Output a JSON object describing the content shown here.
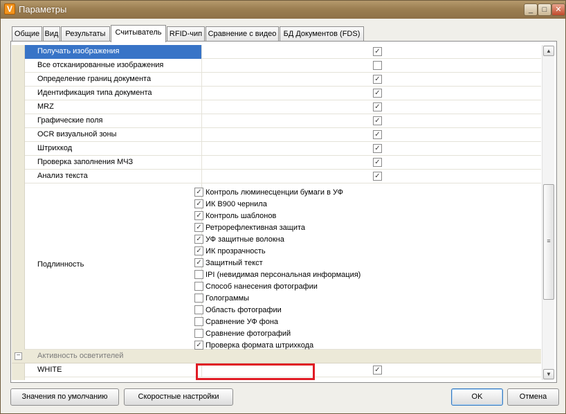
{
  "window": {
    "title": "Параметры",
    "app_icon": "V"
  },
  "tabs": [
    {
      "label": "Общие"
    },
    {
      "label": "Вид"
    },
    {
      "label": "Результаты"
    },
    {
      "label": "Считыватель"
    },
    {
      "label": "RFID-чип"
    },
    {
      "label": "Сравнение с видео"
    },
    {
      "label": "БД Документов (FDS)"
    }
  ],
  "active_tab": "Считыватель",
  "rows": [
    {
      "label": "Получать изображения",
      "checked": true,
      "mark": "✓"
    },
    {
      "label": "Все отсканированные изображения",
      "checked": false,
      "mark": ""
    },
    {
      "label": "Определение границ документа",
      "checked": true,
      "mark": "✓"
    },
    {
      "label": "Идентификация типа документа",
      "checked": true,
      "mark": "✓"
    },
    {
      "label": "MRZ",
      "checked": true,
      "mark": "✓"
    },
    {
      "label": "Графические поля",
      "checked": true,
      "mark": "✓"
    },
    {
      "label": "OCR визуальной зоны",
      "checked": true,
      "mark": "✓"
    },
    {
      "label": "Штрихкод",
      "checked": true,
      "mark": "✓"
    },
    {
      "label": "Проверка заполнения МЧЗ",
      "checked": true,
      "mark": "✓"
    },
    {
      "label": "Анализ текста",
      "checked": true,
      "mark": "✓"
    }
  ],
  "authenticity": {
    "label": "Подлинность",
    "items": [
      {
        "label": "Контроль люминесценции бумаги в УФ",
        "checked": true,
        "mark": "✓"
      },
      {
        "label": "ИК В900 чернила",
        "checked": true,
        "mark": "✓"
      },
      {
        "label": "Контроль шаблонов",
        "checked": true,
        "mark": "✓"
      },
      {
        "label": "Ретрорефлективная защита",
        "checked": true,
        "mark": "✓"
      },
      {
        "label": "УФ защитные волокна",
        "checked": true,
        "mark": "✓"
      },
      {
        "label": "ИК прозрачность",
        "checked": true,
        "mark": "✓"
      },
      {
        "label": "Защитный текст",
        "checked": true,
        "mark": "✓"
      },
      {
        "label": "IPI (невидимая персональная информация)",
        "checked": false,
        "mark": ""
      },
      {
        "label": "Способ нанесения фотографии",
        "checked": false,
        "mark": ""
      },
      {
        "label": "Голограммы",
        "checked": false,
        "mark": ""
      },
      {
        "label": "Область фотографии",
        "checked": false,
        "mark": ""
      },
      {
        "label": "Сравнение УФ фона",
        "checked": false,
        "mark": ""
      },
      {
        "label": "Сравнение фотографий",
        "checked": false,
        "mark": ""
      },
      {
        "label": "Проверка формата штрихкода",
        "checked": true,
        "mark": "✓"
      }
    ]
  },
  "group": {
    "label": "Активность осветителей",
    "expander": "−"
  },
  "white_row": {
    "label": "WHITE",
    "checked": true,
    "mark": "✓"
  },
  "scrollbar": {
    "up": "▲",
    "down": "▼",
    "grip": "≡"
  },
  "buttons": {
    "defaults": "Значения по умолчанию",
    "speed": "Скоростные настройки",
    "ok": "OK",
    "cancel": "Отмена"
  },
  "titlebar_buttons": {
    "minimize": "_",
    "maximize": "□",
    "close": "✕"
  },
  "colors": {
    "highlight": "#e01b24",
    "selection": "#3874c7"
  }
}
